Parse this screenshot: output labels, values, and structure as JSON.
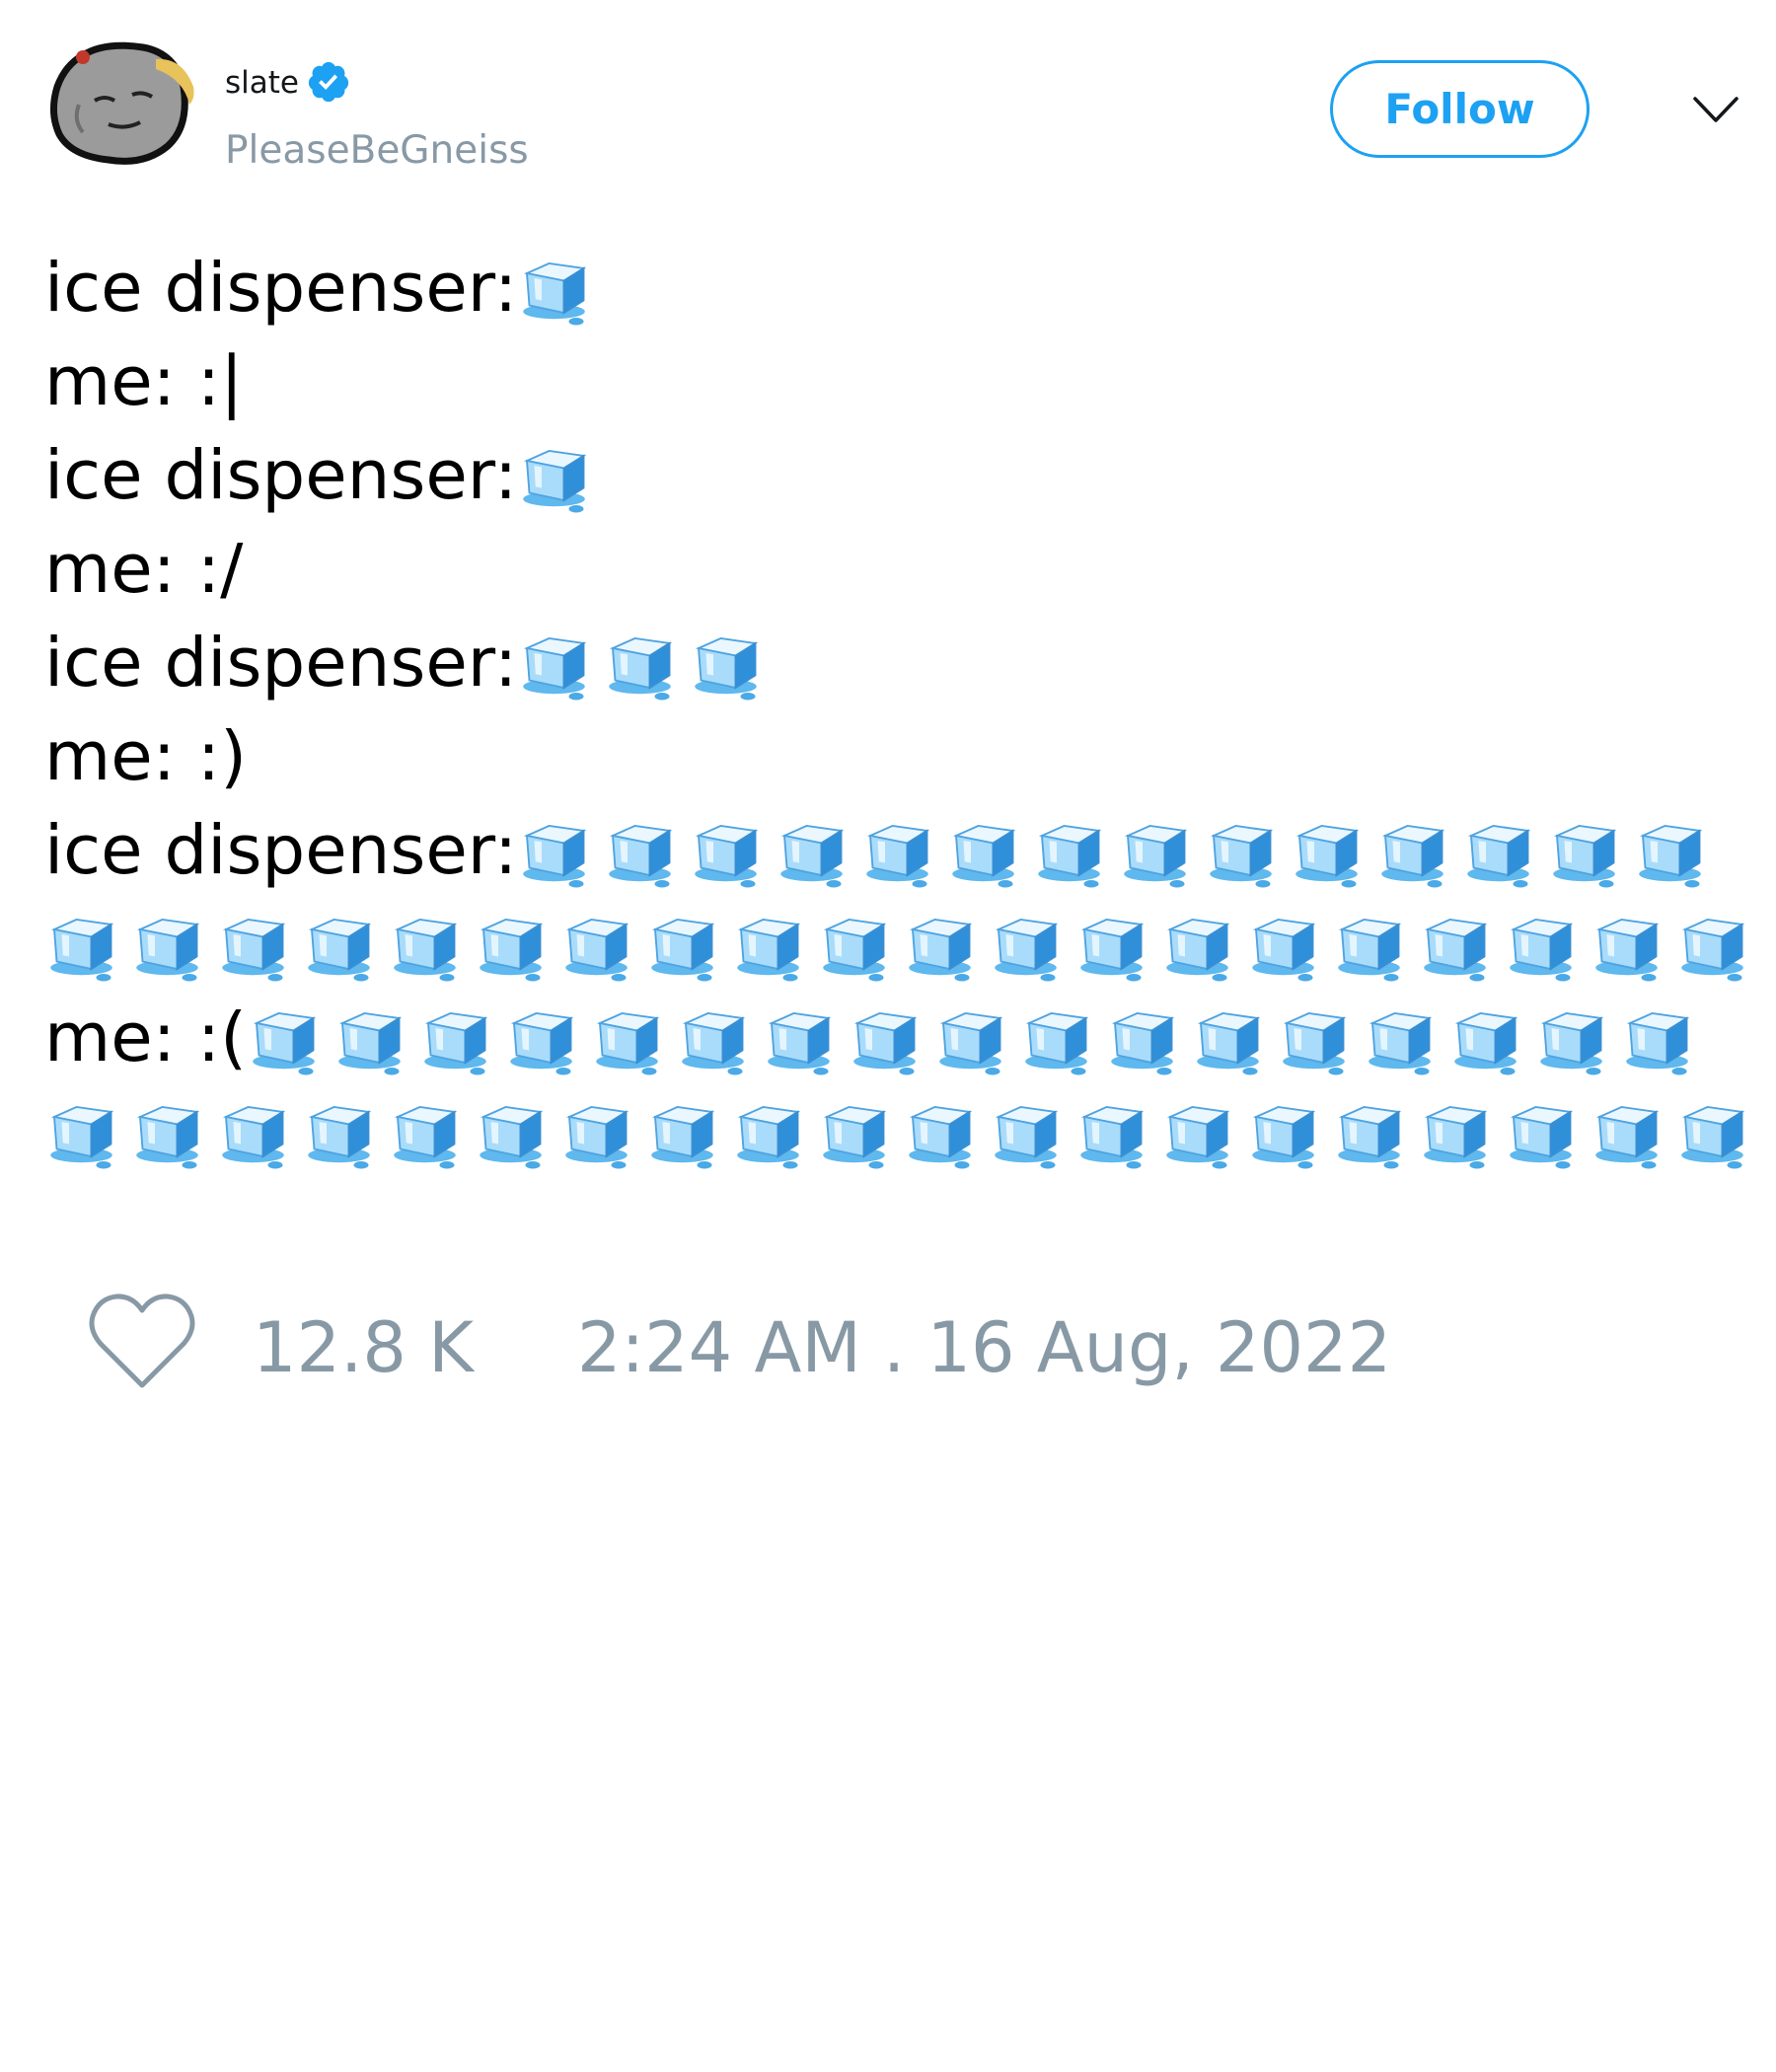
{
  "author": {
    "display_name": "slate",
    "handle": "PleaseBeGneiss",
    "verified": true,
    "avatar_icon": "rock-face-avatar"
  },
  "actions": {
    "follow_label": "Follow",
    "more_icon": "chevron-down-icon"
  },
  "tweet": {
    "lines": [
      {
        "text": "ice dispenser: ",
        "ice_count": 1
      },
      {
        "text": "me: :|",
        "ice_count": 0
      },
      {
        "text": "ice dispenser: ",
        "ice_count": 1
      },
      {
        "text": "me: :/",
        "ice_count": 0
      },
      {
        "text": "ice dispenser: ",
        "ice_count": 3
      },
      {
        "text": "me: :)",
        "ice_count": 0
      },
      {
        "text": "ice dispenser: ",
        "ice_count": 14
      },
      {
        "text": "",
        "ice_count": 20
      },
      {
        "text": "me: :(",
        "ice_count": 17
      },
      {
        "text": "",
        "ice_count": 20
      }
    ],
    "emoji_icon": "ice-cube-emoji"
  },
  "footer": {
    "like_icon": "heart-icon",
    "like_count": "12.8 K",
    "timestamp": "2:24 AM . 16 Aug, 2022"
  },
  "colors": {
    "accent": "#1da1f2",
    "muted": "#8899a6",
    "text": "#000000"
  }
}
